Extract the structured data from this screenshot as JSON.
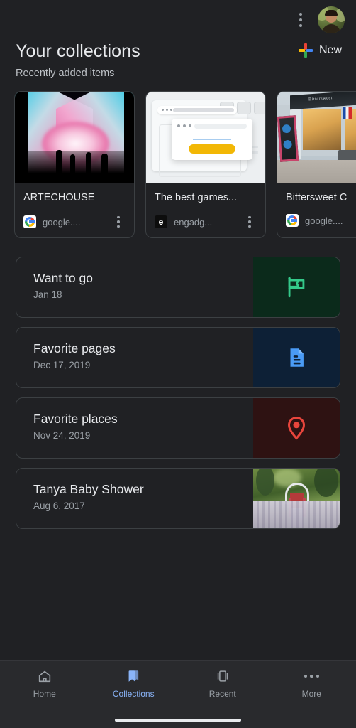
{
  "header": {
    "title": "Your collections",
    "subtitle": "Recently added items",
    "new_label": "New",
    "overflow_icon": "kebab-menu-icon",
    "avatar_icon": "account-avatar"
  },
  "recent_cards": [
    {
      "title": "ARTECHOUSE",
      "source": "google....",
      "favicon": "google-favicon",
      "thumb": "artechouse-light-art-photo",
      "more_icon": "more-options-icon"
    },
    {
      "title": "The best games...",
      "source": "engadg...",
      "favicon": "engadget-favicon",
      "thumb": "browser-window-illustration",
      "more_icon": "more-options-icon"
    },
    {
      "title": "Bittersweet C",
      "source": "google....",
      "favicon": "google-favicon",
      "thumb": "storefront-photo",
      "more_icon": "more-options-icon"
    }
  ],
  "collections": [
    {
      "title": "Want to go",
      "date": "Jan 18",
      "icon": "flag-icon",
      "tile_color": "#0b2a1b",
      "icon_color": "#34c98a"
    },
    {
      "title": "Favorite pages",
      "date": "Dec 17, 2019",
      "icon": "document-icon",
      "tile_color": "#0d2036",
      "icon_color": "#4a9bf5"
    },
    {
      "title": "Favorite places",
      "date": "Nov 24, 2019",
      "icon": "map-pin-icon",
      "tile_color": "#2e1212",
      "icon_color": "#e8453c"
    },
    {
      "title": "Tanya Baby Shower",
      "date": "Aug 6, 2017",
      "icon": "photo-thumbnail",
      "tile_color": "#4a6034",
      "icon_color": ""
    }
  ],
  "bottom_nav": [
    {
      "label": "Home",
      "icon": "home-icon",
      "active": false
    },
    {
      "label": "Collections",
      "icon": "collections-icon",
      "active": true
    },
    {
      "label": "Recent",
      "icon": "recent-tabs-icon",
      "active": false
    },
    {
      "label": "More",
      "icon": "more-dots-icon",
      "active": false
    }
  ],
  "theme": {
    "background": "#202124",
    "nav_background": "#292a2d",
    "accent": "#8ab4f8",
    "text_primary": "#e8eaed",
    "text_secondary": "#9aa0a6"
  }
}
